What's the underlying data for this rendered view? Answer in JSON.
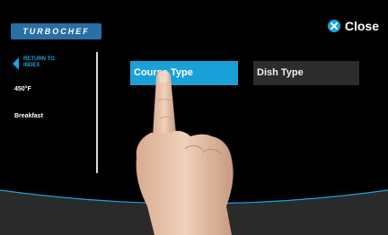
{
  "header": {
    "logo_text": "TURBOCHEF",
    "close_label": "Close",
    "close_icon": "close-icon"
  },
  "sidebar": {
    "back_label": "RETURN TO INDEX",
    "temperature": "450°F",
    "meal": "Breakfast"
  },
  "tabs": [
    {
      "label": "Course Type",
      "selected": true
    },
    {
      "label": "Dish Type",
      "selected": false
    }
  ],
  "colors": {
    "accent": "#1aa4dc",
    "background": "#000000",
    "tab_inactive": "#2c2c2c"
  }
}
